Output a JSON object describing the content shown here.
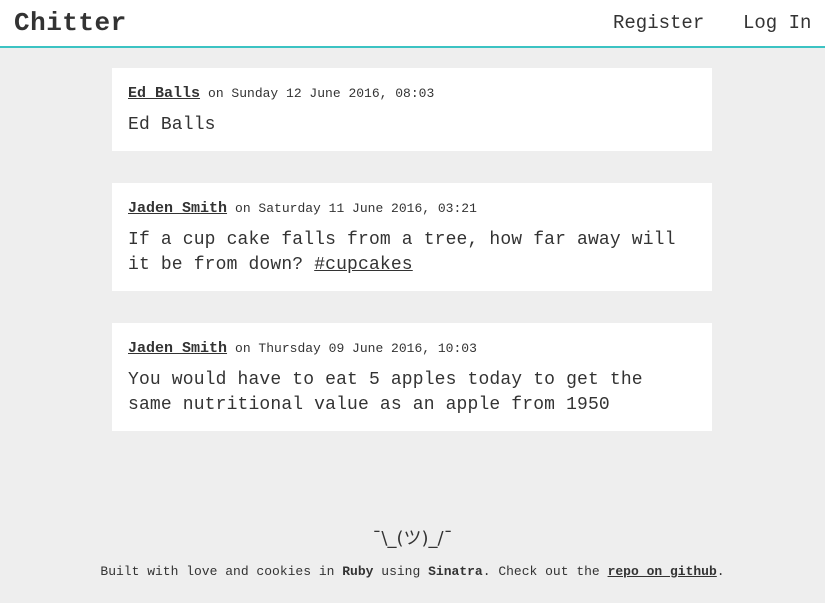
{
  "header": {
    "brand": "Chitter",
    "nav": {
      "register": "Register",
      "login": "Log In"
    },
    "accent_color": "#3cc3c3"
  },
  "peeps": [
    {
      "author": "Ed Balls",
      "date": "on Sunday 12 June 2016, 08:03",
      "text": "Ed Balls"
    },
    {
      "author": "Jaden Smith",
      "date": "on Saturday 11 June 2016, 03:21",
      "text": "If a cup cake falls from a tree, how far away will it be from down?",
      "hashtag": "#cupcakes"
    },
    {
      "author": "Jaden Smith",
      "date": "on Thursday 09 June 2016, 10:03",
      "text": "You would have to eat 5 apples today to get the same nutritional value as an apple from 1950"
    }
  ],
  "footer": {
    "shrug": "¯\\_(ツ)_/¯",
    "built_with": "Built with love and cookies in",
    "ruby": "Ruby",
    "using": "using",
    "sinatra": "Sinatra",
    "check_out": ". Check out the",
    "repo_link": "repo on github",
    "end": "."
  }
}
